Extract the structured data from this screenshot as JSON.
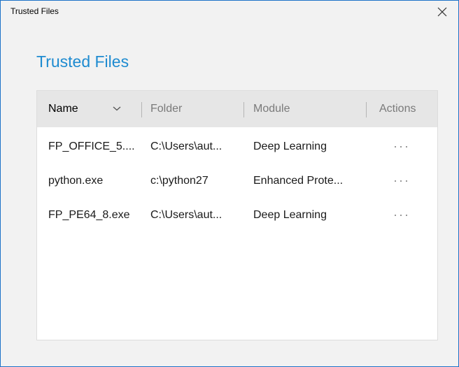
{
  "window": {
    "title": "Trusted Files"
  },
  "page": {
    "heading": "Trusted Files"
  },
  "table": {
    "columns": {
      "name": "Name",
      "folder": "Folder",
      "module": "Module",
      "actions": "Actions"
    },
    "rows": [
      {
        "name": "FP_OFFICE_5....",
        "folder": "C:\\Users\\aut...",
        "module": "Deep Learning"
      },
      {
        "name": "python.exe",
        "folder": "c:\\python27",
        "module": "Enhanced Prote..."
      },
      {
        "name": "FP_PE64_8.exe",
        "folder": "C:\\Users\\aut...",
        "module": "Deep Learning"
      }
    ]
  },
  "colors": {
    "accent": "#1e8bd0",
    "window_border": "#1e73c8",
    "header_bg": "#e6e6e6"
  },
  "icons": {
    "close": "close-icon",
    "sort": "chevron-down-icon",
    "row_action": "more-horizontal-icon"
  }
}
